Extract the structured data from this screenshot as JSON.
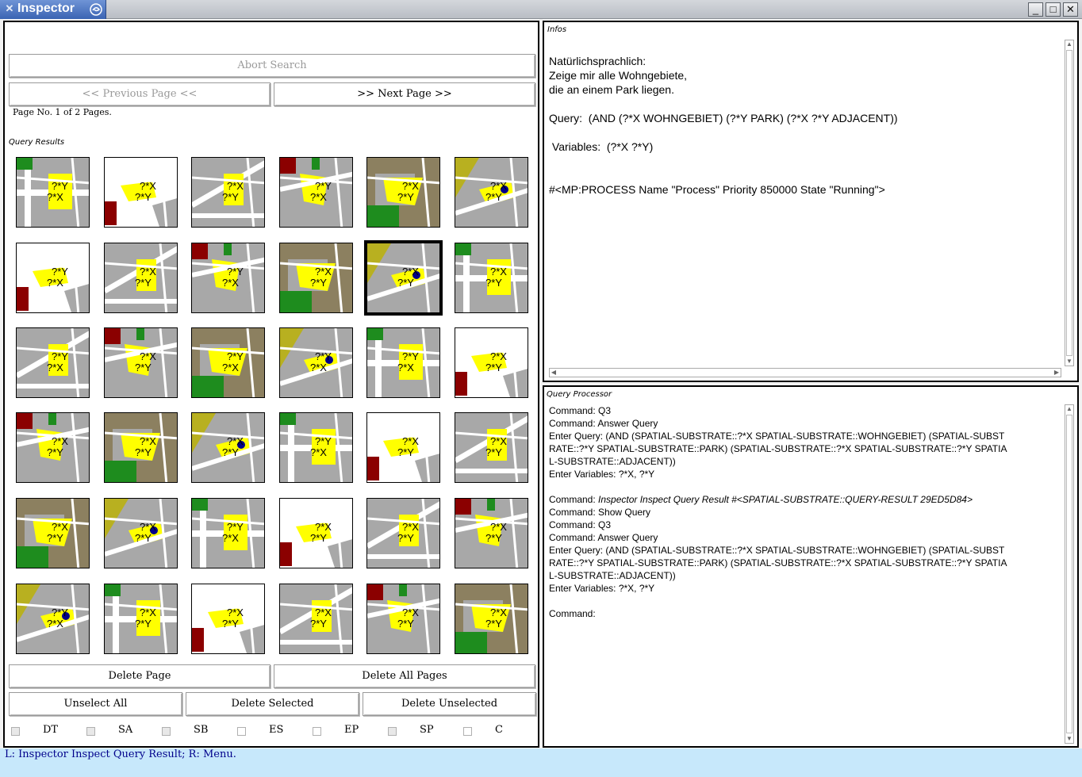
{
  "window": {
    "title": "Inspector"
  },
  "left": {
    "abort_search": "Abort Search",
    "prev_page": "<< Previous Page <<",
    "next_page": ">> Next Page >>",
    "page_info": "Page No. 1 of 2 Pages.",
    "query_results_caption": "Query Results",
    "thumb_labels": [
      [
        "?*Y",
        "?*X"
      ],
      [
        "?*X",
        "?*Y"
      ],
      [
        "?*X",
        "?*Y"
      ],
      [
        "?*Y",
        "?*X"
      ],
      [
        "?*X",
        "?*Y"
      ],
      [
        "?*X",
        "?*Y"
      ],
      [
        "?*Y",
        "?*X"
      ],
      [
        "?*X",
        "?*Y"
      ],
      [
        "?*Y",
        "?*X"
      ],
      [
        "?*X",
        "?*Y"
      ],
      [
        "?*X",
        "?*Y"
      ],
      [
        "?*X",
        "?*Y"
      ],
      [
        "?*Y",
        "?*X"
      ],
      [
        "?*X",
        "?*Y"
      ],
      [
        "?*Y",
        "?*X"
      ],
      [
        "?*Y",
        "?*X"
      ],
      [
        "?*Y",
        "?*X"
      ],
      [
        "?*X",
        "?*Y"
      ],
      [
        "?*X",
        "?*Y"
      ],
      [
        "?*X",
        "?*Y"
      ],
      [
        "?*X",
        "?*Y"
      ],
      [
        "?*Y",
        "?*X"
      ],
      [
        "?*X",
        "?*Y"
      ],
      [
        "?*X",
        "?*Y"
      ],
      [
        "?*X",
        "?*Y"
      ],
      [
        "?*X",
        "?*Y"
      ],
      [
        "?*Y",
        "?*X"
      ],
      [
        "?*X",
        "?*Y"
      ],
      [
        "?*X",
        "?*Y"
      ],
      [
        "?*X",
        "?*Y"
      ],
      [
        "?*Y",
        "?*X"
      ],
      [
        "?*X",
        "?*Y"
      ],
      [
        "?*X",
        "?*Y"
      ],
      [
        "?*X",
        "?*Y"
      ],
      [
        "?*X",
        "?*Y"
      ],
      [
        "?*X",
        "?*Y"
      ]
    ],
    "delete_page": "Delete Page",
    "delete_all_pages": "Delete All Pages",
    "unselect_all": "Unselect All",
    "delete_selected": "Delete Selected",
    "delete_unselected": "Delete Unselected",
    "checkboxes": [
      "DT",
      "SA",
      "SB",
      "ES",
      "EP",
      "SP",
      "C"
    ]
  },
  "infos": {
    "caption": "Infos",
    "line1": "Natürlichsprachlich:",
    "line2": "Zeige mir alle Wohngebiete,",
    "line3": "die an einem Park liegen.",
    "query": "Query:  (AND (?*X WOHNGEBIET) (?*Y PARK) (?*X ?*Y ADJACENT))",
    "variables": " Variables:  (?*X ?*Y)",
    "process": "#<MP:PROCESS Name \"Process\" Priority 850000 State \"Running\">"
  },
  "query_processor": {
    "caption": "Query Processor",
    "lines": [
      "Command: Q3",
      "Command: Answer Query",
      "Enter Query: (AND (SPATIAL-SUBSTRATE::?*X SPATIAL-SUBSTRATE::WOHNGEBIET) (SPATIAL-SUBST",
      "RATE::?*Y SPATIAL-SUBSTRATE::PARK) (SPATIAL-SUBSTRATE::?*X SPATIAL-SUBSTRATE::?*Y SPATIA",
      "L-SUBSTRATE::ADJACENT))",
      "Enter Variables: ?*X, ?*Y",
      "",
      "Command: ",
      "Command: Show Query",
      "Command: Q3",
      "Command: Answer Query",
      "Enter Query: (AND (SPATIAL-SUBSTRATE::?*X SPATIAL-SUBSTRATE::WOHNGEBIET) (SPATIAL-SUBST",
      "RATE::?*Y SPATIAL-SUBSTRATE::PARK) (SPATIAL-SUBSTRATE::?*X SPATIAL-SUBSTRATE::?*Y SPATIA",
      "L-SUBSTRATE::ADJACENT))",
      "Enter Variables: ?*X, ?*Y",
      "",
      "Command:"
    ],
    "italic_command": "Inspector Inspect Query Result #<SPATIAL-SUBSTRATE::QUERY-RESULT 29ED5D84>"
  },
  "status": {
    "text": "L: Inspector Inspect Query Result; R: Menu."
  },
  "colors": {
    "map_gray": "#a8a8a8",
    "street": "#ffffff",
    "residential": "#ffff00",
    "park_green": "#1e8c1e",
    "status_bg": "#c7e8fb"
  }
}
